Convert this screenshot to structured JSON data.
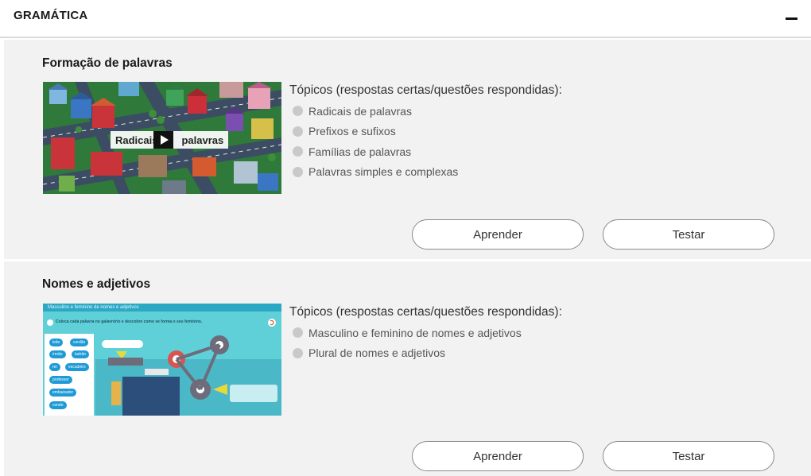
{
  "header": {
    "title": "GRAMÁTICA"
  },
  "sections": [
    {
      "title": "Formação de palavras",
      "thumbnail": {
        "kind": "video",
        "label_left": "Radicais",
        "label_right": "palavras",
        "icon": "play-icon"
      },
      "topics_heading": "Tópicos (respostas certas/questões respondidas):",
      "topics": [
        "Radicais de palavras",
        "Prefixos e sufixos",
        "Famílias de palavras",
        "Palavras simples e complexas"
      ],
      "learn_label": "Aprender",
      "test_label": "Testar"
    },
    {
      "title": "Nomes e adjetivos",
      "thumbnail": {
        "kind": "game",
        "top_bar": "Masculino e feminino de nomes e adjetivos",
        "instruction": "Coloca cada palavra no galavrório e descobre como se forma o seu feminino.",
        "words": [
          "leão",
          "cordão",
          "irmão",
          "ladrão",
          "rei",
          "escudeiro",
          "professor",
          "embaixador",
          "conde"
        ]
      },
      "topics_heading": "Tópicos (respostas certas/questões respondidas):",
      "topics": [
        "Masculino e feminino de nomes e adjetivos",
        "Plural de nomes e adjetivos"
      ],
      "learn_label": "Aprender",
      "test_label": "Testar"
    }
  ],
  "colors": {
    "panel_bg": "#f2f2f2",
    "topic_dot": "#c9c9c9",
    "game_bg": "#5fd0d8",
    "game_blue": "#1e9ad6"
  }
}
